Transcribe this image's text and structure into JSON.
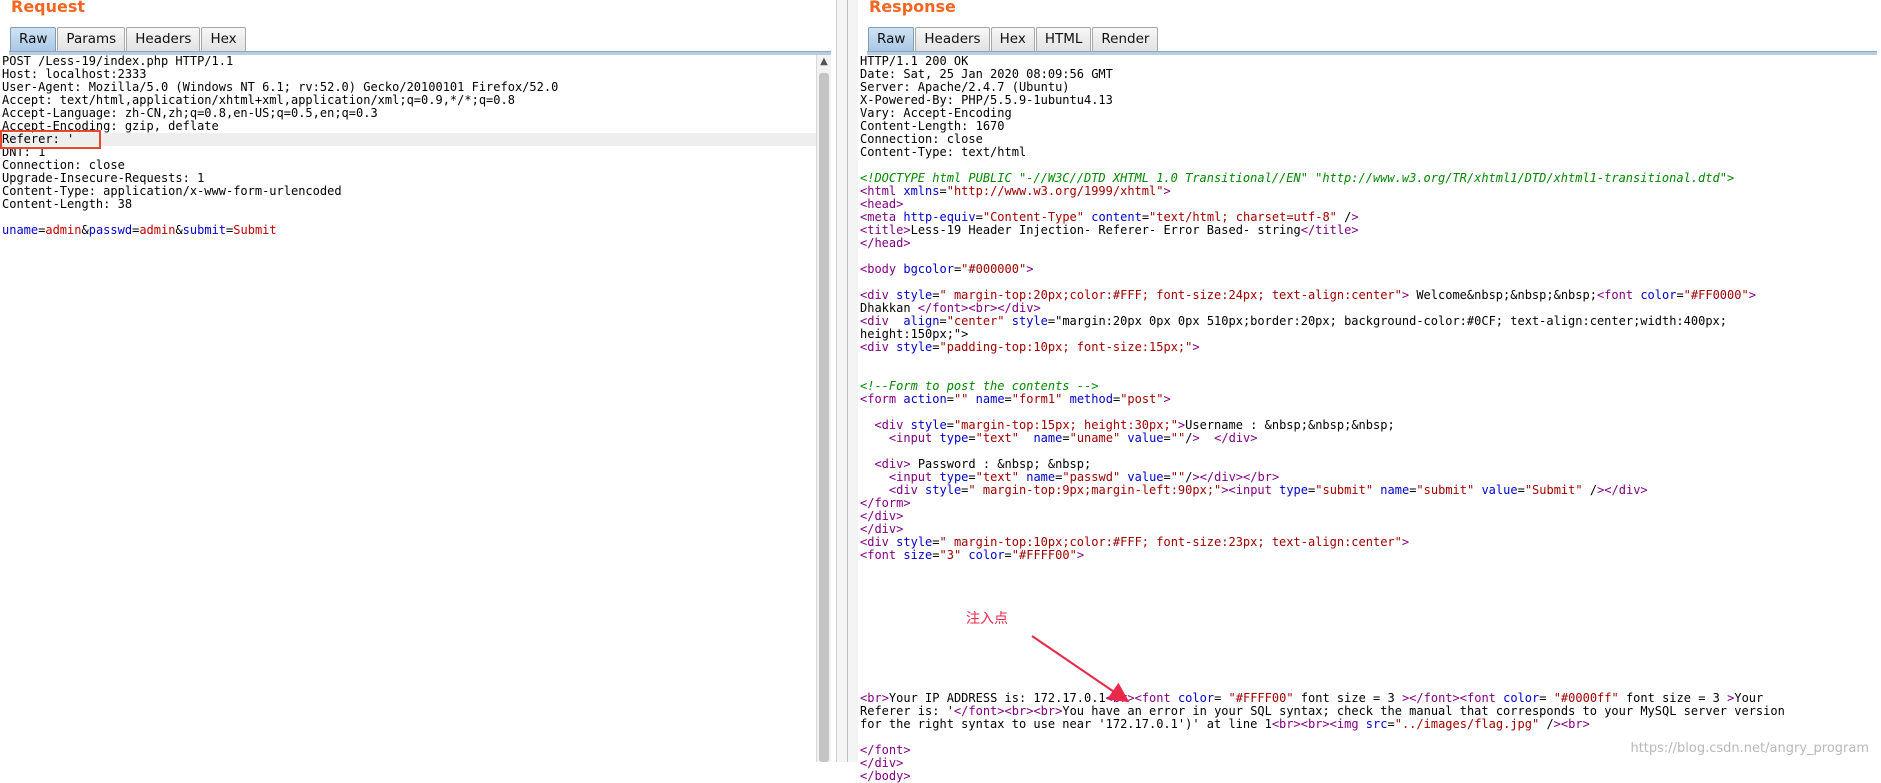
{
  "request": {
    "title": "Request",
    "tabs": [
      "Raw",
      "Params",
      "Headers",
      "Hex"
    ],
    "active_tab": "Raw",
    "lines": [
      "POST /Less-19/index.php HTTP/1.1",
      "Host: localhost:2333",
      "User-Agent: Mozilla/5.0 (Windows NT 6.1; rv:52.0) Gecko/20100101 Firefox/52.0",
      "Accept: text/html,application/xhtml+xml,application/xml;q=0.9,*/*;q=0.8",
      "Accept-Language: zh-CN,zh;q=0.8,en-US;q=0.5,en;q=0.3",
      "Accept-Encoding: gzip, deflate",
      "Referer: '",
      "DNT: 1",
      "Connection: close",
      "Upgrade-Insecure-Requests: 1",
      "Content-Type: application/x-www-form-urlencoded",
      "Content-Length: 38",
      "",
      "uname=admin&passwd=admin&submit=Submit"
    ]
  },
  "response": {
    "title": "Response",
    "tabs": [
      "Raw",
      "Headers",
      "Hex",
      "HTML",
      "Render"
    ],
    "active_tab": "Raw",
    "lines": [
      "HTTP/1.1 200 OK",
      "Date: Sat, 25 Jan 2020 08:09:56 GMT",
      "Server: Apache/2.4.7 (Ubuntu)",
      "X-Powered-By: PHP/5.5.9-1ubuntu4.13",
      "Vary: Accept-Encoding",
      "Content-Length: 1670",
      "Connection: close",
      "Content-Type: text/html",
      "",
      "<!DOCTYPE html PUBLIC \"-//W3C//DTD XHTML 1.0 Transitional//EN\" \"http://www.w3.org/TR/xhtml1/DTD/xhtml1-transitional.dtd\">",
      "<html xmlns=\"http://www.w3.org/1999/xhtml\">",
      "<head>",
      "<meta http-equiv=\"Content-Type\" content=\"text/html; charset=utf-8\" />",
      "<title>Less-19 Header Injection- Referer- Error Based- string</title>",
      "</head>",
      "",
      "<body bgcolor=\"#000000\">",
      "",
      "<div style=\" margin-top:20px;color:#FFF; font-size:24px; text-align:center\"> Welcome&nbsp;&nbsp;&nbsp;<font color=\"#FF0000\">",
      "Dhakkan </font><br></div>",
      "<div  align=\"center\" style=\"margin:20px 0px 0px 510px;border:20px; background-color:#0CF; text-align:center;width:400px;",
      "height:150px;\">",
      "<div style=\"padding-top:10px; font-size:15px;\">",
      "",
      "",
      "<!--Form to post the contents -->",
      "<form action=\"\" name=\"form1\" method=\"post\">",
      "",
      "  <div style=\"margin-top:15px; height:30px;\">Username : &nbsp;&nbsp;&nbsp;",
      "    <input type=\"text\"  name=\"uname\" value=\"\"/>  </div>",
      "",
      "  <div> Password : &nbsp; &nbsp;",
      "    <input type=\"text\" name=\"passwd\" value=\"\"/></div></br>",
      "    <div style=\" margin-top:9px;margin-left:90px;\"><input type=\"submit\" name=\"submit\" value=\"Submit\" /></div>",
      "</form>",
      "</div>",
      "</div>",
      "<div style=\" margin-top:10px;color:#FFF; font-size:23px; text-align:center\">",
      "<font size=\"3\" color=\"#FFFF00\">",
      "",
      "",
      "",
      "",
      "",
      "",
      "",
      "",
      "",
      "",
      "<br>Your IP ADDRESS is: 172.17.0.1<br><font color= \"#FFFF00\" font size = 3 ></font><font color= \"#0000ff\" font size = 3 >Your",
      "Referer is: '</font><br><br>You have an error in your SQL syntax; check the manual that corresponds to your MySQL server version",
      "for the right syntax to use near '172.17.0.1')' at line 1<br><br><img src=\"../images/flag.jpg\" /><br>",
      "",
      "</font>",
      "</div>",
      "</body>"
    ]
  },
  "annotation": {
    "label": "注入点"
  },
  "watermark": "https://blog.csdn.net/angry_program",
  "colors": {
    "title": "#f26522",
    "annotation": "#e8294a",
    "active_tab": "#a9c8e6"
  }
}
